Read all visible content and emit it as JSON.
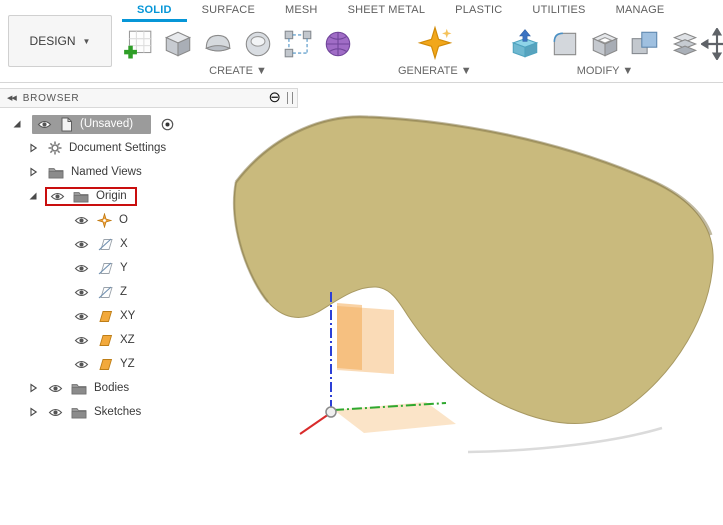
{
  "toolbar": {
    "design_label": "DESIGN",
    "design_caret": "▼",
    "tabs": [
      "SOLID",
      "SURFACE",
      "MESH",
      "SHEET METAL",
      "PLASTIC",
      "UTILITIES",
      "MANAGE"
    ],
    "active_tab": "SOLID",
    "groups": [
      {
        "label": "CREATE",
        "caret": "▼",
        "icons": [
          "create-sketch-icon",
          "box-icon",
          "sweep-icon",
          "cylinder-icon",
          "pattern-icon",
          "form-icon"
        ]
      },
      {
        "label": "GENERATE",
        "caret": "▼",
        "icons": [
          "generate-icon"
        ]
      },
      {
        "label": "MODIFY",
        "caret": "▼",
        "icons": [
          "press-pull-icon",
          "fillet-icon",
          "shell-icon",
          "combine-icon",
          "pattern-stack-icon"
        ]
      }
    ],
    "right_icon": "move-icon",
    "accent_color": "#0696D7"
  },
  "browser": {
    "collapse_icon": "◀◀",
    "title": "BROWSER",
    "minus_icon": "⊖",
    "tree": [
      {
        "label": "(Unsaved)",
        "level": 0,
        "expander": "expanded",
        "eye": true,
        "icon": "document",
        "selected": true,
        "radio": true
      },
      {
        "label": "Document Settings",
        "level": 1,
        "expander": "collapsed",
        "eye": false,
        "icon": "gear"
      },
      {
        "label": "Named Views",
        "level": 1,
        "expander": "collapsed",
        "eye": false,
        "icon": "folder"
      },
      {
        "label": "Origin",
        "level": 1,
        "expander": "expanded",
        "eye": true,
        "icon": "folder",
        "annotated": true
      },
      {
        "label": "O",
        "level": 2,
        "eye": true,
        "icon": "origin-point"
      },
      {
        "label": "X",
        "level": 2,
        "eye": true,
        "icon": "axis"
      },
      {
        "label": "Y",
        "level": 2,
        "eye": true,
        "icon": "axis"
      },
      {
        "label": "Z",
        "level": 2,
        "eye": true,
        "icon": "axis"
      },
      {
        "label": "XY",
        "level": 2,
        "eye": true,
        "icon": "plane"
      },
      {
        "label": "XZ",
        "level": 2,
        "eye": true,
        "icon": "plane"
      },
      {
        "label": "YZ",
        "level": 2,
        "eye": true,
        "icon": "plane"
      },
      {
        "label": "Bodies",
        "level": 1,
        "expander": "collapsed",
        "eye": true,
        "icon": "folder"
      },
      {
        "label": "Sketches",
        "level": 1,
        "expander": "collapsed",
        "eye": true,
        "icon": "folder"
      }
    ]
  },
  "canvas": {
    "body_color": "#C9BA7D",
    "body_edge_color": "#8E8153",
    "plane_color": "#F3A64A",
    "annotation_color": "#C90E0E",
    "axis_colors": {
      "x": "#D92B2B",
      "y": "#2EA82E",
      "z": "#2C3FD6"
    }
  }
}
